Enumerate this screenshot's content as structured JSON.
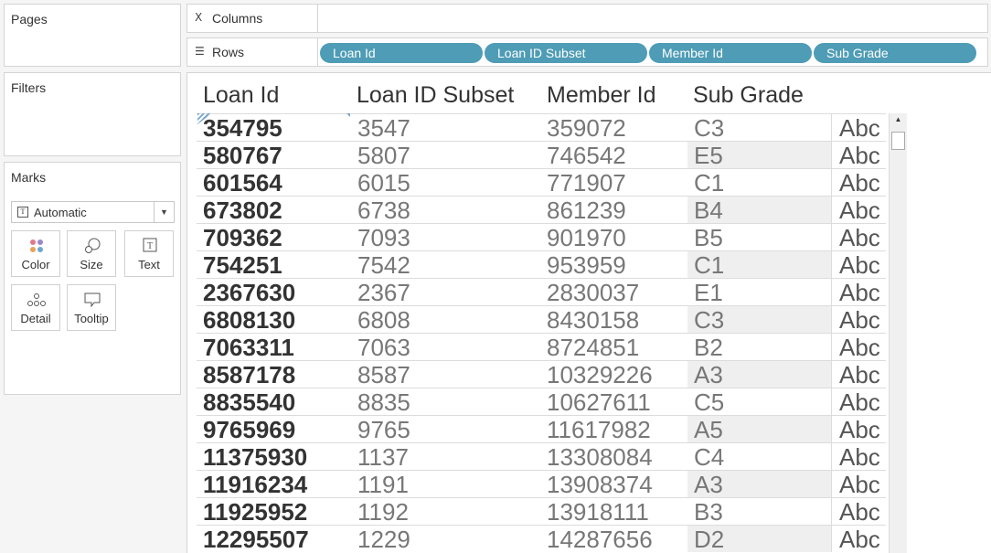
{
  "left_panel": {
    "pages_title": "Pages",
    "filters_title": "Filters",
    "marks_title": "Marks",
    "mark_type": "Automatic",
    "mark_buttons": {
      "color": "Color",
      "size": "Size",
      "text": "Text",
      "detail": "Detail",
      "tooltip": "Tooltip"
    }
  },
  "shelves": {
    "columns_label": "Columns",
    "rows_label": "Rows",
    "rows_pills": [
      "Loan Id",
      "Loan ID Subset",
      "Member Id",
      "Sub Grade"
    ]
  },
  "colors": {
    "pill": "#4e9cb5",
    "grade_shade": "#efefef"
  },
  "table": {
    "headers": {
      "loan_id": "Loan Id",
      "loan_id_subset": "Loan ID Subset",
      "member_id": "Member Id",
      "sub_grade": "Sub Grade"
    },
    "rows": [
      {
        "loan_id": "354795",
        "subset": "3547",
        "member_id": "359072",
        "grade": "C3",
        "abc": "Abc"
      },
      {
        "loan_id": "580767",
        "subset": "5807",
        "member_id": "746542",
        "grade": "E5",
        "abc": "Abc"
      },
      {
        "loan_id": "601564",
        "subset": "6015",
        "member_id": "771907",
        "grade": "C1",
        "abc": "Abc"
      },
      {
        "loan_id": "673802",
        "subset": "6738",
        "member_id": "861239",
        "grade": "B4",
        "abc": "Abc"
      },
      {
        "loan_id": "709362",
        "subset": "7093",
        "member_id": "901970",
        "grade": "B5",
        "abc": "Abc"
      },
      {
        "loan_id": "754251",
        "subset": "7542",
        "member_id": "953959",
        "grade": "C1",
        "abc": "Abc"
      },
      {
        "loan_id": "2367630",
        "subset": "2367",
        "member_id": "2830037",
        "grade": "E1",
        "abc": "Abc"
      },
      {
        "loan_id": "6808130",
        "subset": "6808",
        "member_id": "8430158",
        "grade": "C3",
        "abc": "Abc"
      },
      {
        "loan_id": "7063311",
        "subset": "7063",
        "member_id": "8724851",
        "grade": "B2",
        "abc": "Abc"
      },
      {
        "loan_id": "8587178",
        "subset": "8587",
        "member_id": "10329226",
        "grade": "A3",
        "abc": "Abc"
      },
      {
        "loan_id": "8835540",
        "subset": "8835",
        "member_id": "10627611",
        "grade": "C5",
        "abc": "Abc"
      },
      {
        "loan_id": "9765969",
        "subset": "9765",
        "member_id": "11617982",
        "grade": "A5",
        "abc": "Abc"
      },
      {
        "loan_id": "11375930",
        "subset": "1137",
        "member_id": "13308084",
        "grade": "C4",
        "abc": "Abc"
      },
      {
        "loan_id": "11916234",
        "subset": "1191",
        "member_id": "13908374",
        "grade": "A3",
        "abc": "Abc"
      },
      {
        "loan_id": "11925952",
        "subset": "1192",
        "member_id": "13918111",
        "grade": "B3",
        "abc": "Abc"
      },
      {
        "loan_id": "12295507",
        "subset": "1229",
        "member_id": "14287656",
        "grade": "D2",
        "abc": "Abc"
      }
    ]
  }
}
